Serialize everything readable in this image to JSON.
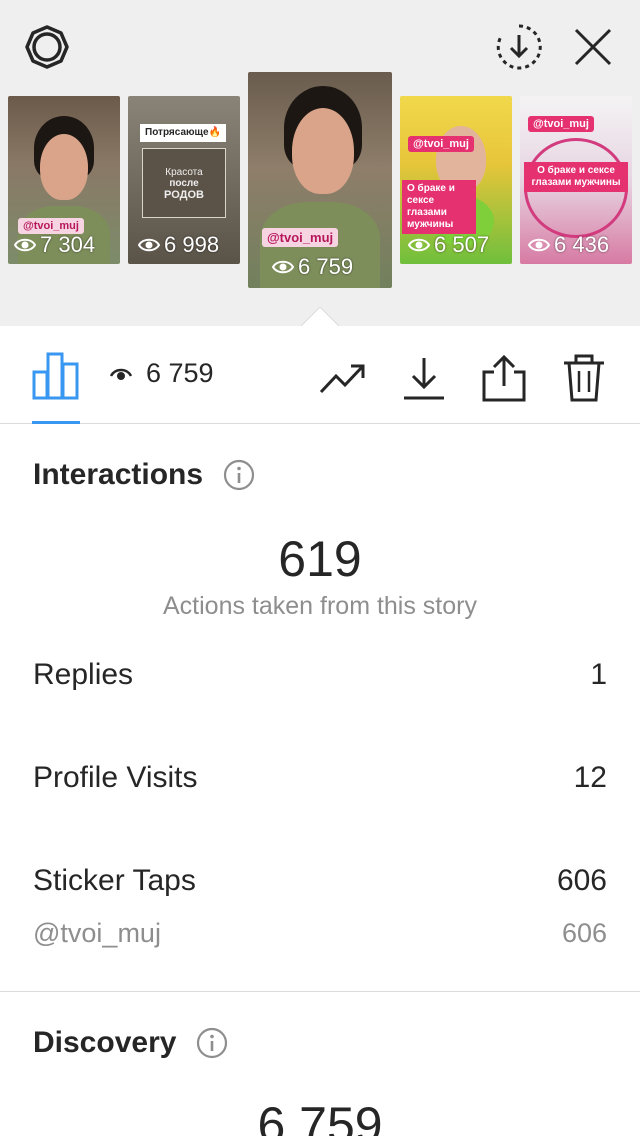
{
  "stories": [
    {
      "views": "7 304",
      "sticker": "@tvoi_muj"
    },
    {
      "views": "6 998",
      "headline": "Потрясающе🔥",
      "caption_line1": "Красота",
      "caption_line2": "после",
      "caption_line3": "РОДОВ"
    },
    {
      "views": "6 759",
      "sticker": "@tvoi_muj"
    },
    {
      "views": "6 507",
      "sticker": "@tvoi_muj",
      "caption": "О браке и сексе глазами мужчины"
    },
    {
      "views": "6 436",
      "sticker": "@tvoi_muj",
      "caption": "О браке и сексе глазами мужчины"
    }
  ],
  "toolbar": {
    "views": "6 759"
  },
  "interactions": {
    "title": "Interactions",
    "total": "619",
    "subtitle": "Actions taken from this story",
    "rows": [
      {
        "label": "Replies",
        "value": "1"
      },
      {
        "label": "Profile Visits",
        "value": "12"
      },
      {
        "label": "Sticker Taps",
        "value": "606"
      }
    ],
    "sticker_detail": {
      "label": "@tvoi_muj",
      "value": "606"
    }
  },
  "discovery": {
    "title": "Discovery",
    "total": "6 759"
  },
  "colors": {
    "accent": "#3897f0",
    "text": "#262626",
    "muted": "#8e8e8e",
    "strip_bg": "#efefef"
  }
}
